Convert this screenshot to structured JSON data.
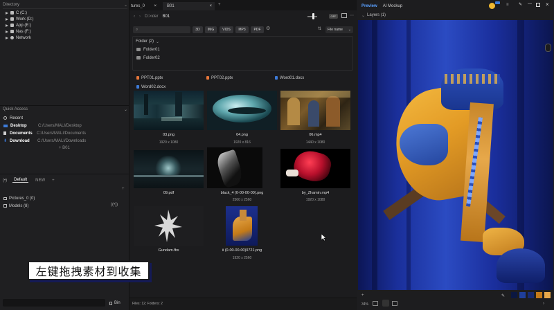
{
  "left": {
    "directory_title": "Directory",
    "drives": [
      {
        "label": "C (C:)"
      },
      {
        "label": "Work (D:)"
      },
      {
        "label": "App (E:)"
      },
      {
        "label": "Nas (F:)"
      },
      {
        "label": "Network"
      }
    ],
    "quick_access_title": "Quick Access",
    "quick_items": [
      {
        "label": "Recent",
        "path": ""
      },
      {
        "label": "Desktop",
        "path": "C:/Users/MALI/Desktop"
      },
      {
        "label": "Documents",
        "path": "C:/Users/MALI/Documents"
      },
      {
        "label": "Download",
        "path": "C:/Users/MALI/Downloads"
      }
    ],
    "add_item": "+ B01",
    "collection_tabs": [
      "Default",
      "NEW"
    ],
    "collections": [
      {
        "label": "Pictures_0 (0)"
      },
      {
        "label": "Models (8)"
      }
    ],
    "bin_label": "Bin"
  },
  "tabs": [
    {
      "label": "tures_0"
    },
    {
      "label": "B01"
    }
  ],
  "breadcrumb": {
    "parent": "D:>ider",
    "current": "B01"
  },
  "toggle": "OFF",
  "toolbar": {
    "filters": [
      "3D",
      "IMG",
      "VIDS",
      "MP3",
      "PDF"
    ],
    "sort_label": "File name"
  },
  "folder_header": "Folder (2)",
  "folders": [
    "Folder01",
    "Folder02"
  ],
  "docs": [
    {
      "name": "PPT01.pptx",
      "color": "#e8773a"
    },
    {
      "name": "PPT02.pptx",
      "color": "#e8773a"
    },
    {
      "name": "Word01.docx",
      "color": "#3d7bd9"
    },
    {
      "name": "Word02.docx",
      "color": "#3d7bd9"
    }
  ],
  "grid": [
    {
      "name": "03.png",
      "dims": "1920 x 1080"
    },
    {
      "name": "04.png",
      "dims": "1920 x 816"
    },
    {
      "name": "06.mp4",
      "dims": "1440 x 1080"
    },
    {
      "name": "09.pdf",
      "dims": ""
    },
    {
      "name": "black_4 (0-00-00-00).png",
      "dims": "2560 x 2560"
    },
    {
      "name": "by_Zhamin.mp4",
      "dims": "1920 x 1080"
    },
    {
      "name": "Gundam.fbx",
      "dims": ""
    },
    {
      "name": "ii (0-00-00-00)0721.png",
      "dims": "1920 x 2560"
    }
  ],
  "status": "Files: 12; Folders: 2",
  "right": {
    "tabs": [
      "Preview",
      "AI Mockup"
    ],
    "layers_label": "Layers (1)",
    "zoom": "34%",
    "swatches": [
      "#0b1740",
      "#1f3f9a",
      "#172a70",
      "#c47a18",
      "#e7a84a"
    ]
  },
  "overlay_caption": "左键拖拽素材到收集"
}
